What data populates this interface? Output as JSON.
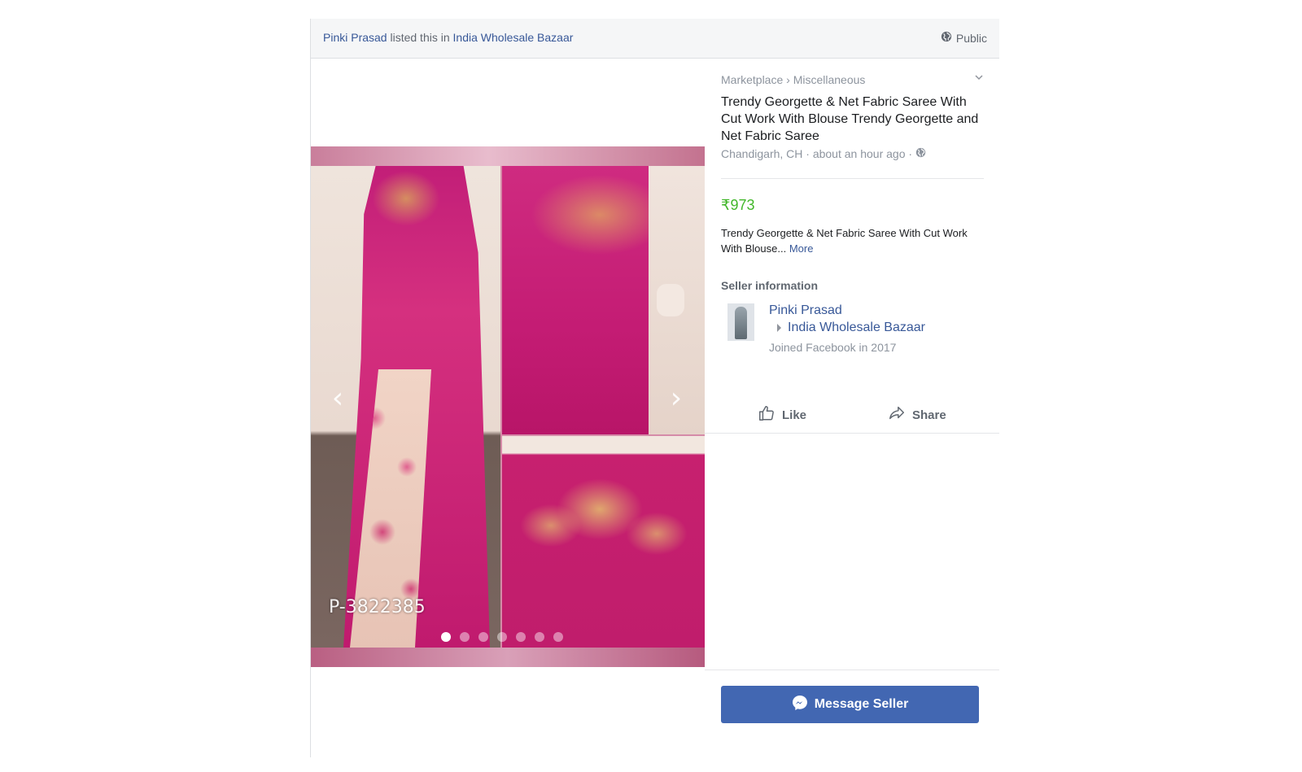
{
  "header": {
    "poster_name": "Pinki Prasad",
    "listed_text": " listed this in ",
    "group_name": "India Wholesale Bazaar",
    "audience_label": "Public",
    "audience_icon": "globe-icon"
  },
  "gallery": {
    "watermark": "P-3822385",
    "total_images": 7,
    "current_index": 1,
    "prev_icon": "chevron-left-icon",
    "next_icon": "chevron-right-icon"
  },
  "listing": {
    "breadcrumb": "Marketplace › Miscellaneous",
    "title": "Trendy Georgette & Net Fabric Saree With Cut Work With Blouse Trendy Georgette and Net Fabric Saree",
    "location_time": "Chandigarh, CH · about an hour ago ·",
    "price": "₹973",
    "description": "Trendy Georgette & Net Fabric Saree With Cut Work With Blouse... ",
    "more_label": "More"
  },
  "seller": {
    "heading": "Seller information",
    "name": "Pinki Prasad",
    "group": "India Wholesale Bazaar",
    "joined": "Joined Facebook in 2017"
  },
  "actions": {
    "like_label": "Like",
    "share_label": "Share",
    "message_label": "Message Seller"
  },
  "colors": {
    "link": "#385898",
    "price": "#42b72a",
    "button": "#4267b2"
  }
}
